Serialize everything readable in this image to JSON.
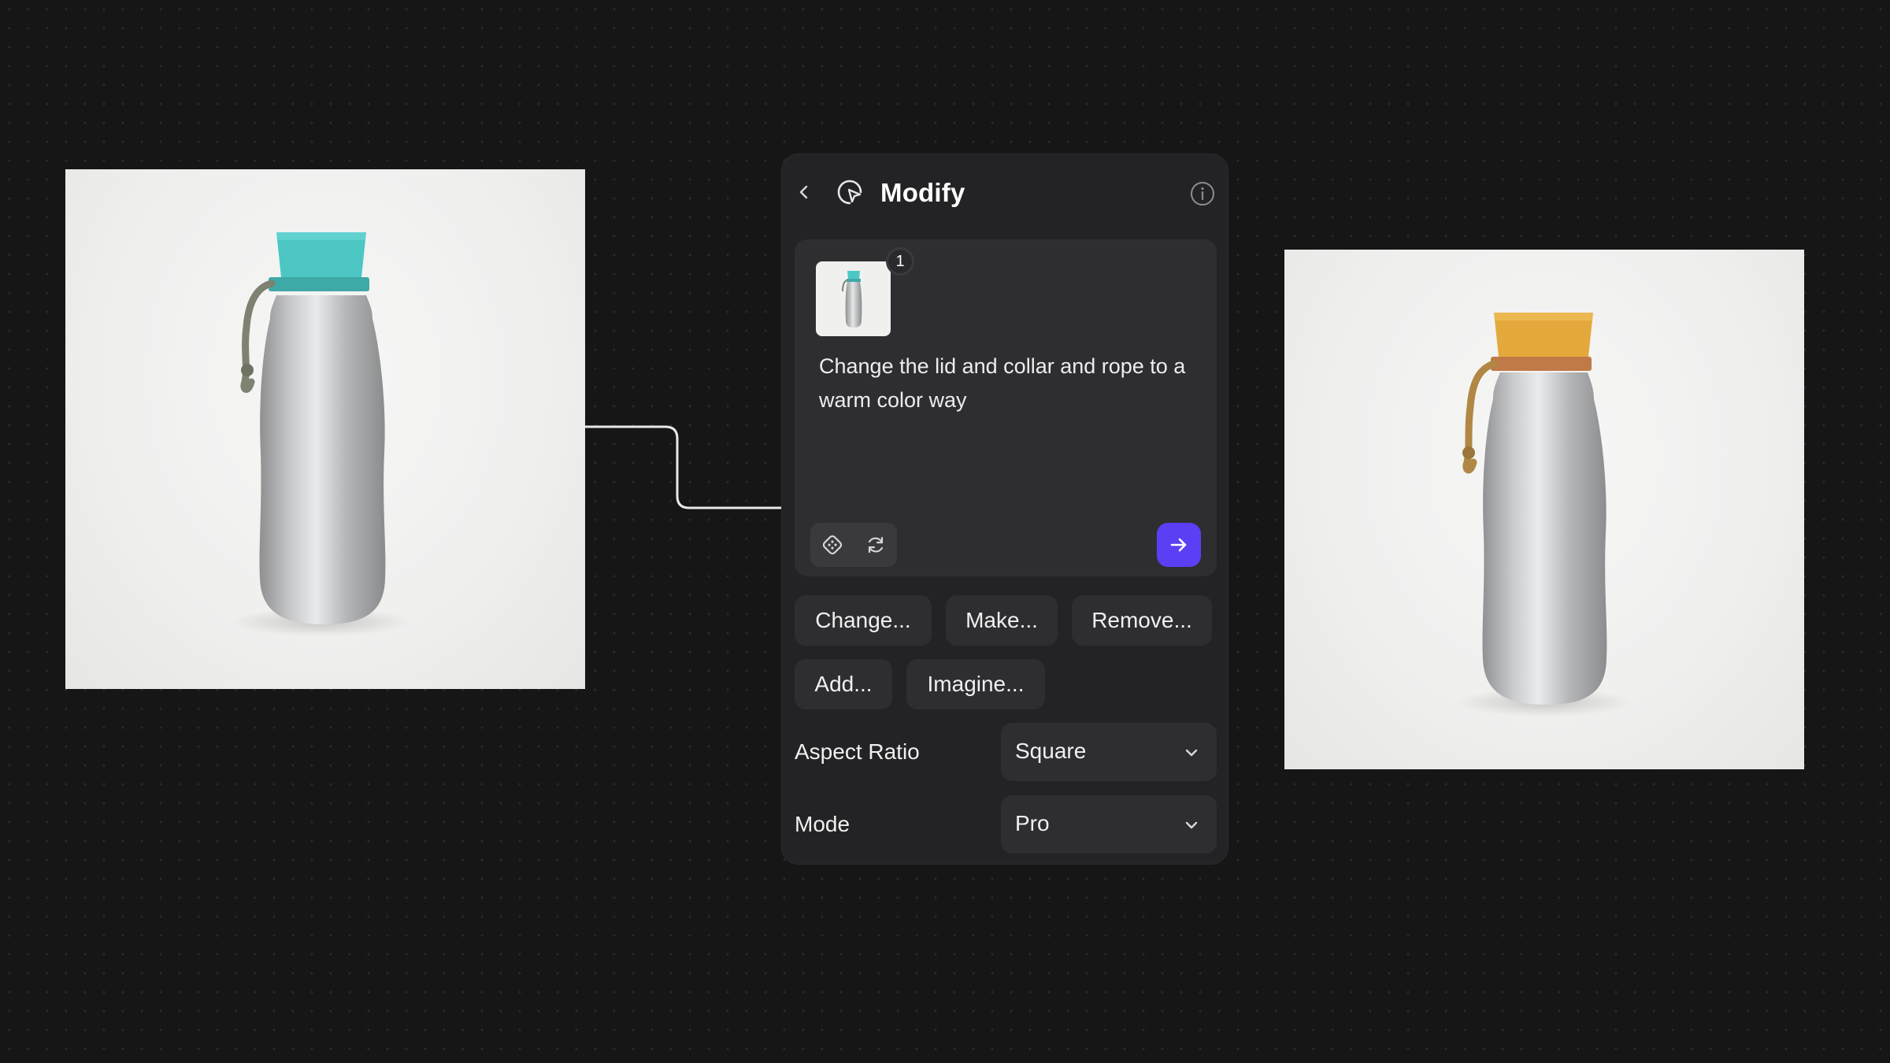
{
  "panel": {
    "title": "Modify",
    "back_icon": "chevron-left-icon",
    "title_icon": "cursor-sparkle-icon",
    "info_icon": "info-icon"
  },
  "prompt": {
    "reference_count": "1",
    "text": "Change the lid and collar and rope to a warm color way",
    "tools": [
      "dice-icon",
      "refresh-icon"
    ],
    "submit_icon": "arrow-right-icon"
  },
  "suggestions": [
    "Change...",
    "Make...",
    "Remove...",
    "Add...",
    "Imagine..."
  ],
  "settings": {
    "aspect_ratio": {
      "label": "Aspect Ratio",
      "value": "Square"
    },
    "mode": {
      "label": "Mode",
      "value": "Pro"
    }
  },
  "images": {
    "source": {
      "lid_color": "#4cc7c4",
      "rope_color": "#7d8271"
    },
    "result": {
      "lid_color": "#e4a93c",
      "rope_color": "#b08744"
    }
  },
  "colors": {
    "accent": "#5b3ff5",
    "panel_bg": "#232325",
    "canvas_bg": "#161617"
  }
}
